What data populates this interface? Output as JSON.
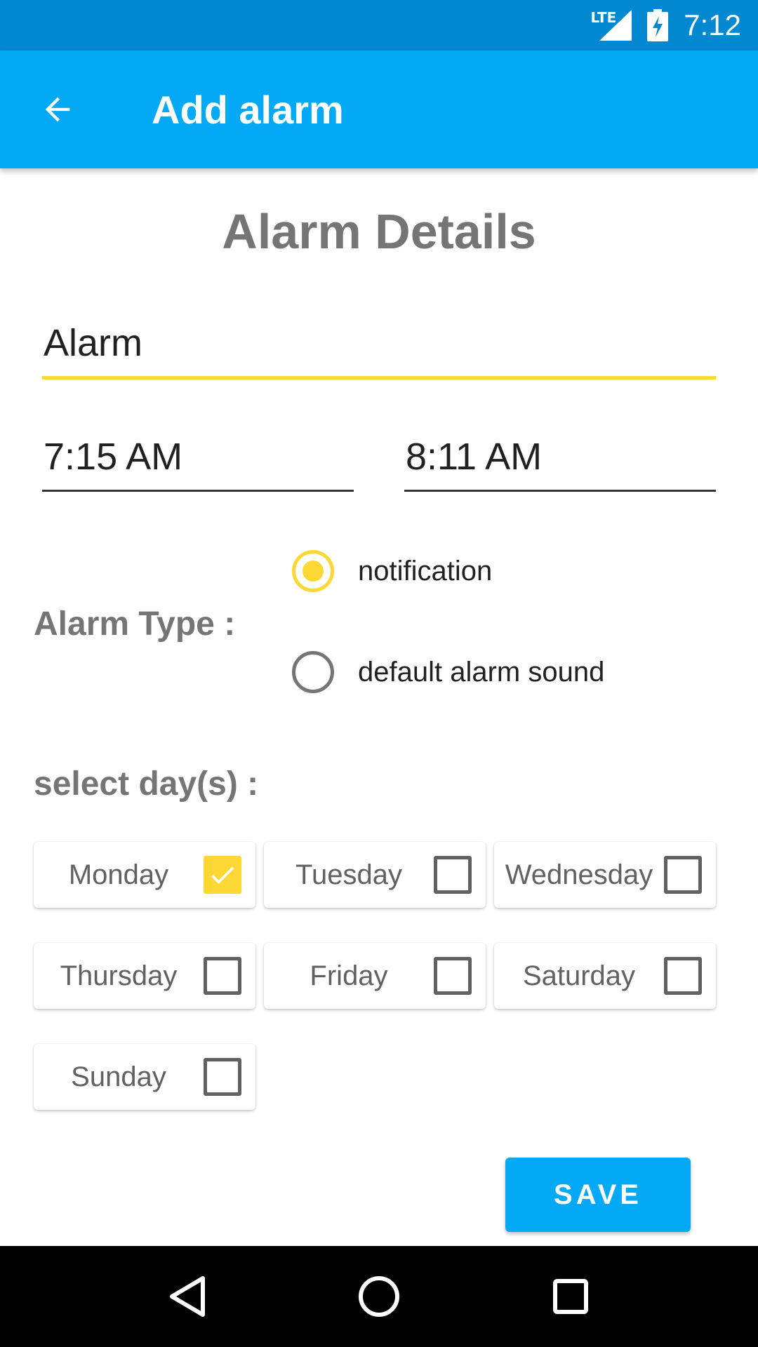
{
  "status_bar": {
    "network": "LTE",
    "time": "7:12"
  },
  "app_bar": {
    "title": "Add alarm"
  },
  "section_title": "Alarm Details",
  "form": {
    "name_value": "Alarm",
    "start_time": "7:15 AM",
    "end_time": "8:11 AM"
  },
  "alarm_type": {
    "label": "Alarm Type :",
    "options": [
      {
        "label": "notification",
        "selected": true
      },
      {
        "label": "default alarm sound",
        "selected": false
      }
    ]
  },
  "days": {
    "label": "select day(s) :",
    "items": [
      {
        "name": "Monday",
        "checked": true
      },
      {
        "name": "Tuesday",
        "checked": false
      },
      {
        "name": "Wednesday",
        "checked": false
      },
      {
        "name": "Thursday",
        "checked": false
      },
      {
        "name": "Friday",
        "checked": false
      },
      {
        "name": "Saturday",
        "checked": false
      },
      {
        "name": "Sunday",
        "checked": false
      }
    ]
  },
  "save_label": "SAVE",
  "colors": {
    "status_bar": "#0288d1",
    "app_bar": "#03a9f4",
    "accent": "#fdd835",
    "heading_gray": "#757575"
  },
  "icons": {
    "back": "arrow-back-icon",
    "nav_back": "nav-back-icon",
    "nav_home": "nav-home-icon",
    "nav_recents": "nav-recents-icon"
  }
}
